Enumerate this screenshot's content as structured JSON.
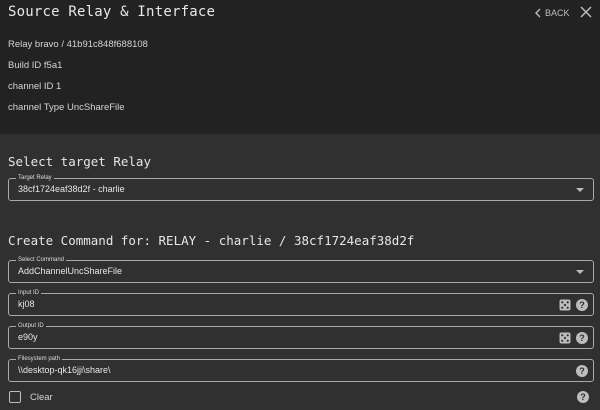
{
  "header": {
    "title": "Source Relay & Interface",
    "back_label": "BACK"
  },
  "source_info": {
    "relay": "Relay  bravo / 41b91c848f688108",
    "build_id": "Build ID f5a1",
    "channel_id": "channel ID 1",
    "channel_type": "channel Type UncShareFile"
  },
  "target_section": {
    "heading": "Select target Relay",
    "target_relay": {
      "label": "Target Relay",
      "value": "38cf1724eaf38d2f - charlie"
    }
  },
  "command_section": {
    "heading": "Create Command for: RELAY - charlie / 38cf1724eaf38d2f",
    "select_command": {
      "label": "Select Command",
      "value": "AddChannelUncShareFile"
    },
    "input_id": {
      "label": "Input ID",
      "value": "kj08"
    },
    "output_id": {
      "label": "Output ID",
      "value": "e90y"
    },
    "filesystem_path": {
      "label": "Filesystem path",
      "value": "\\\\desktop-qk16jji\\share\\"
    },
    "clear": {
      "label": "Clear"
    }
  },
  "icons": {
    "back": "chevron-left-icon",
    "close": "close-icon",
    "dropdown": "arrow-drop-down-icon",
    "randomize": "dice-icon",
    "help": "help-circle-icon"
  },
  "colors": {
    "background": "#303030",
    "top_panel": "#222222",
    "field_border": "#a8a8a8",
    "icon": "#bdbdbd"
  }
}
